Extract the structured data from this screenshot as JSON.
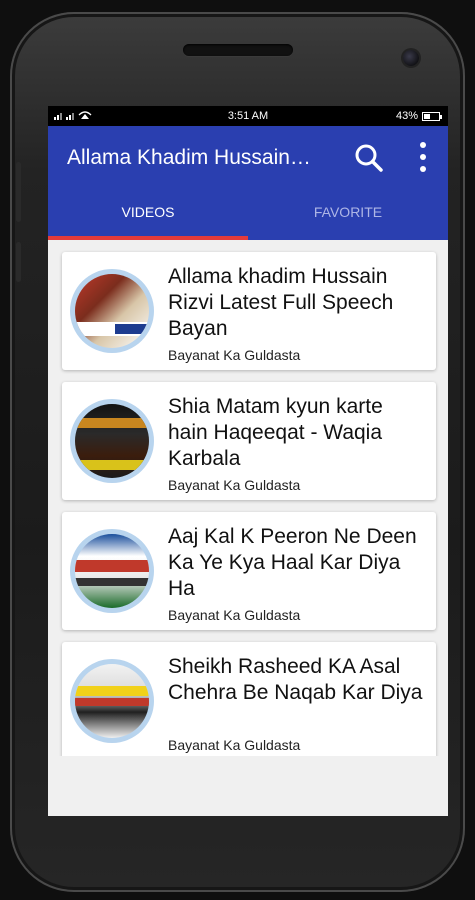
{
  "status_bar": {
    "time": "3:51 AM",
    "battery_level": "43%",
    "battery_fraction": 0.43
  },
  "app_bar": {
    "title": "Allama Khadim Hussain…",
    "search_icon": "search-icon",
    "more_icon": "more-vert-icon"
  },
  "tabs": [
    {
      "label": "VIDEOS",
      "active": true
    },
    {
      "label": "FAVORITE",
      "active": false
    }
  ],
  "videos": [
    {
      "title": "Allama khadim Hussain Rizvi Latest Full Speech Bayan",
      "channel": "Bayanat Ka Guldasta"
    },
    {
      "title": "Shia Matam kyun karte hain Haqeeqat - Waqia Karbala",
      "channel": "Bayanat Ka Guldasta"
    },
    {
      "title": "Aaj Kal K Peeron Ne Deen Ka Ye Kya Haal Kar Diya Ha",
      "channel": "Bayanat Ka Guldasta"
    },
    {
      "title": "Sheikh Rasheed KA Asal Chehra Be Naqab Kar Diya",
      "channel": "Bayanat Ka Guldasta"
    }
  ],
  "colors": {
    "primary": "#2a3fb0",
    "tab_indicator": "#e43b3b",
    "background": "#f0f0f0"
  }
}
